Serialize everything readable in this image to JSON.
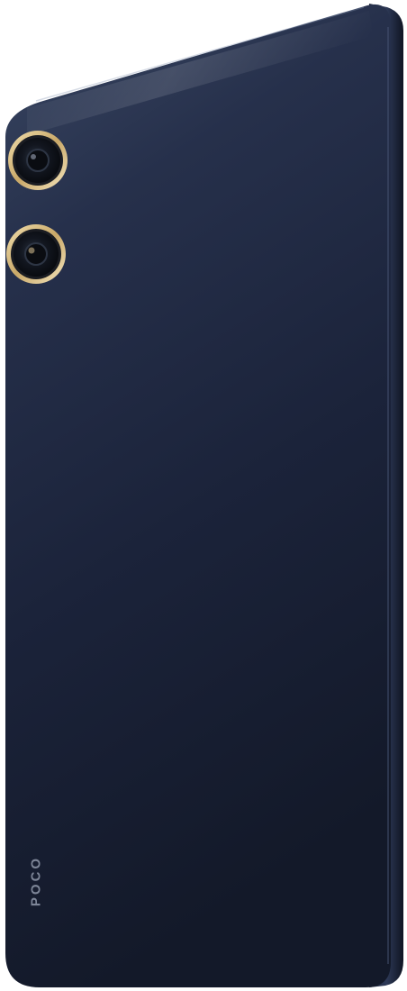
{
  "product": {
    "brand_label": "POCO"
  },
  "colors": {
    "background": "#ffffff",
    "body_top": "#34405a",
    "body_mid": "#1d2640",
    "body_bottom": "#141a2b",
    "frame_edge": "#0f1422",
    "camera_ring": "#d8bf8a",
    "lens": "#0c0f16",
    "logo_text": "#7e8698"
  },
  "icons": {
    "camera_lens": "camera-lens-icon"
  }
}
